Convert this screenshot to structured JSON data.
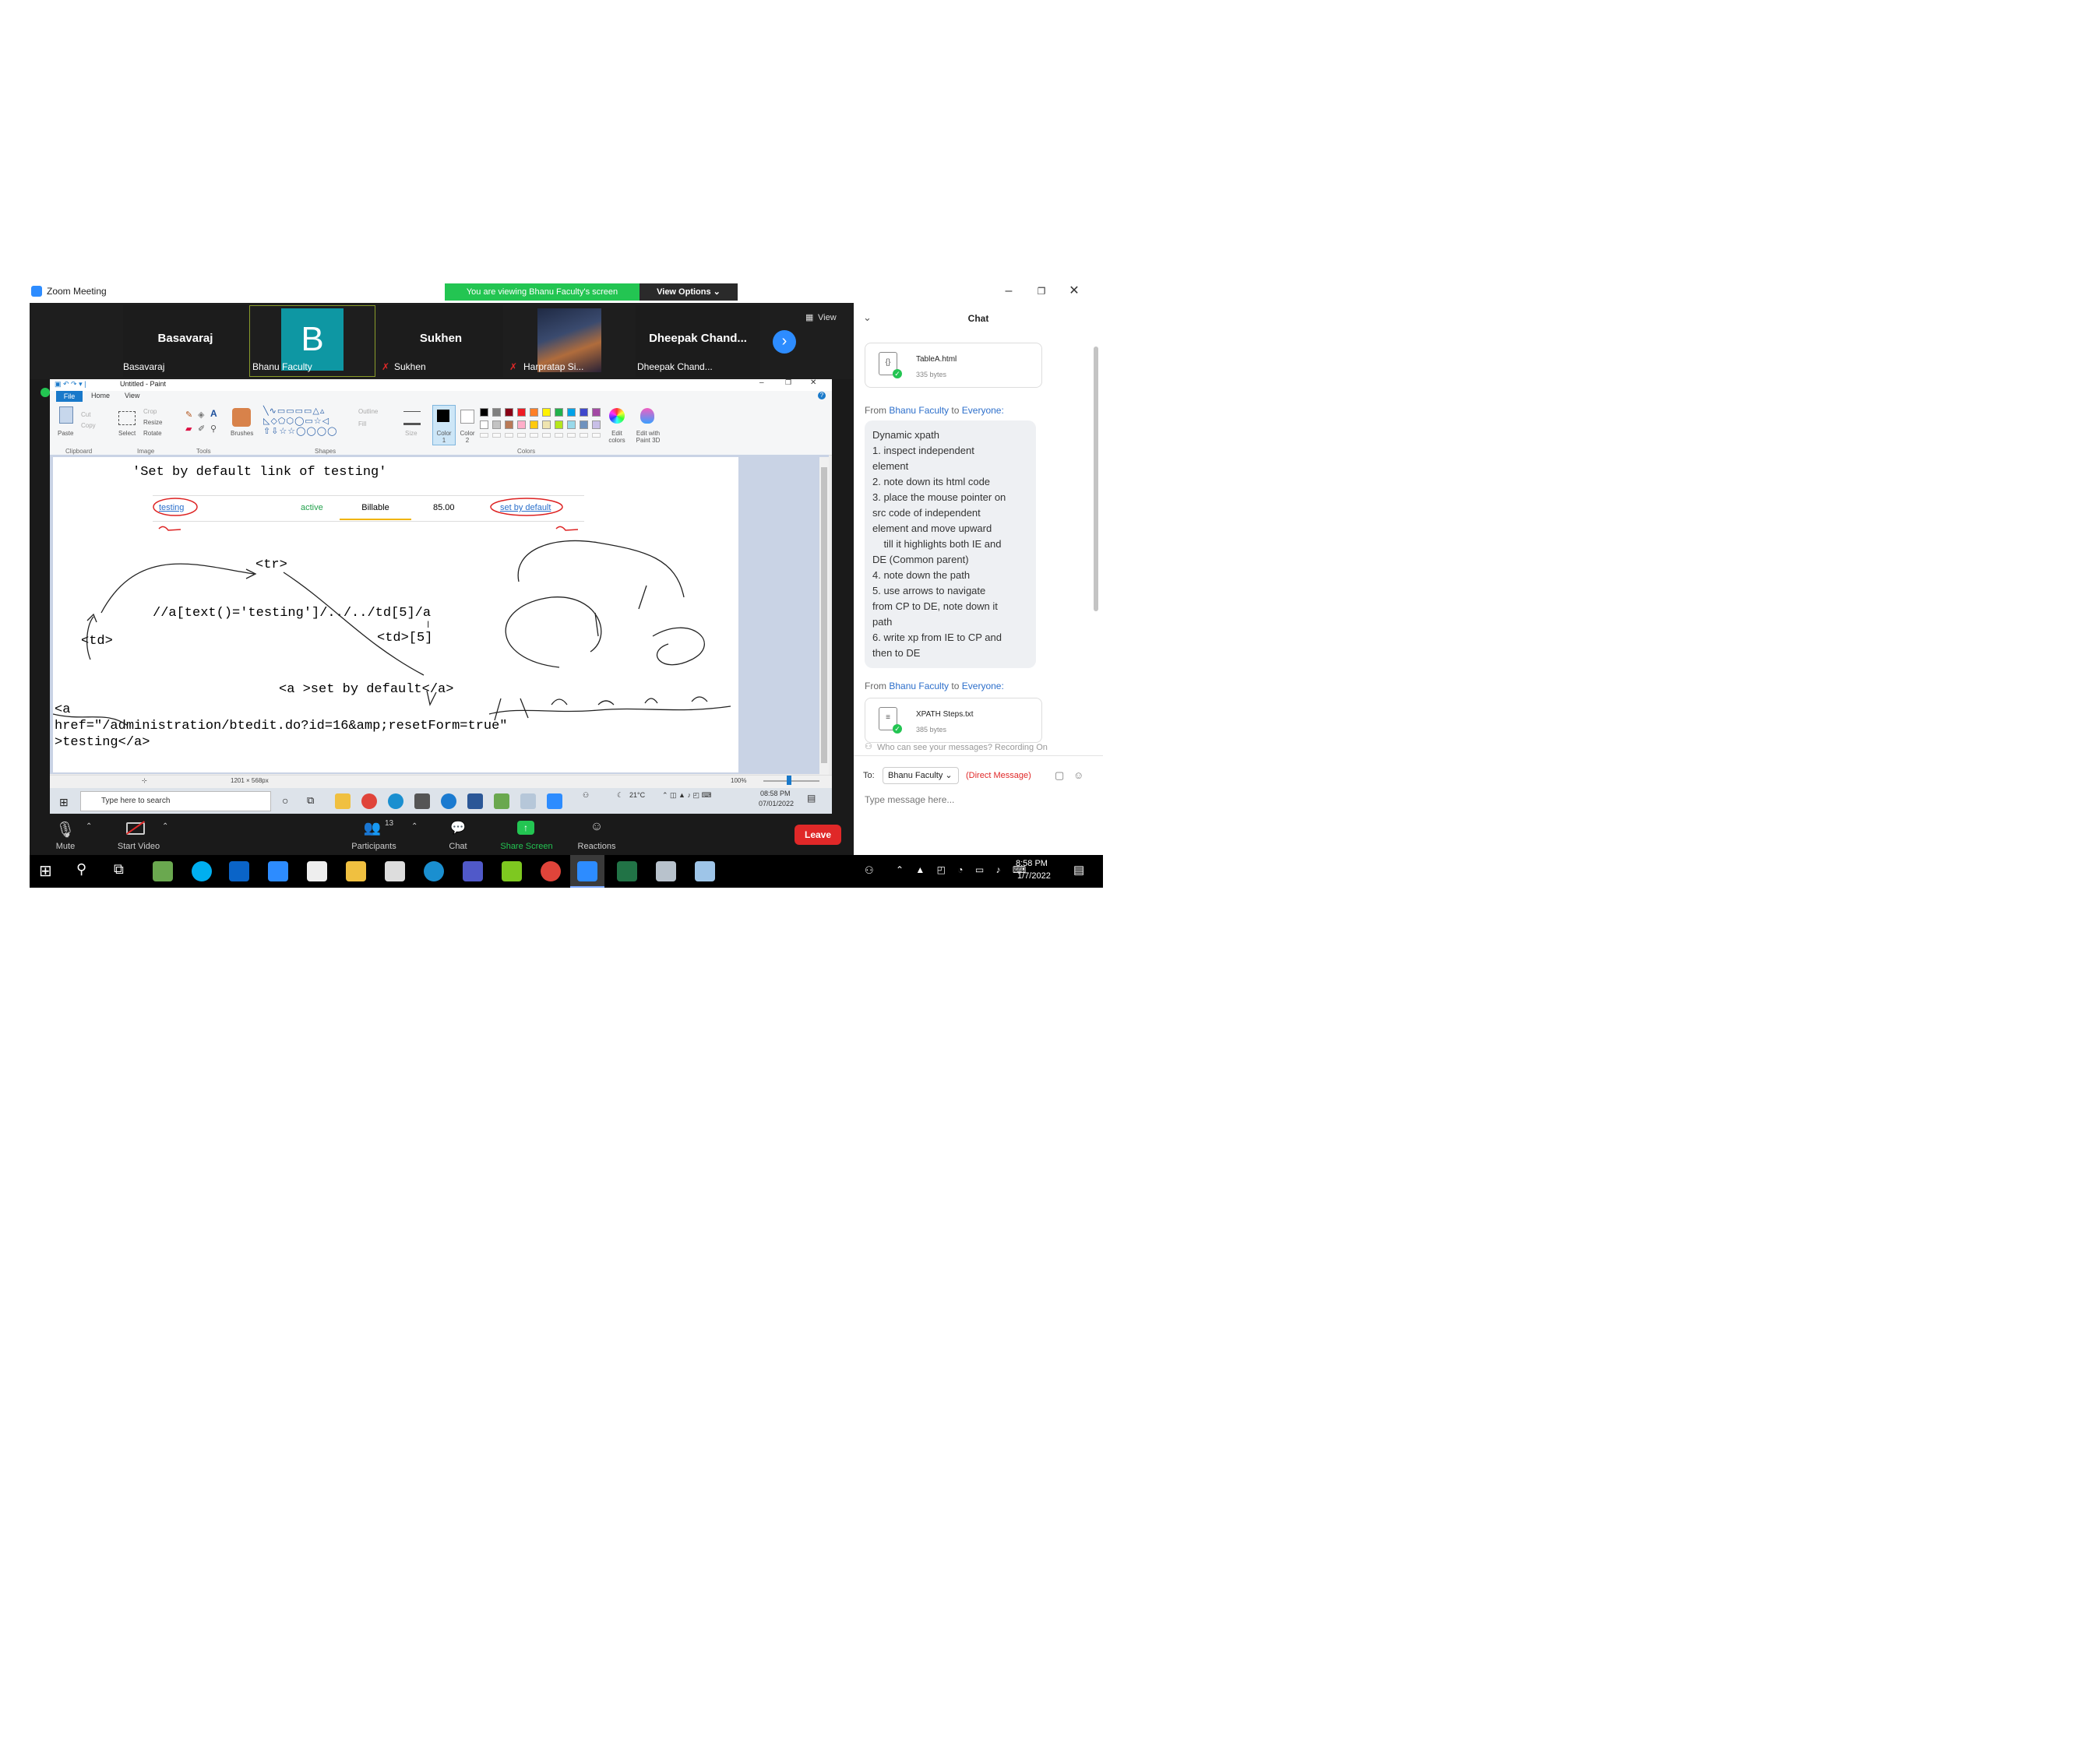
{
  "window": {
    "title": "Zoom Meeting",
    "viewing_banner": "You are viewing Bhanu Faculty's screen",
    "view_options": "View Options ⌄",
    "view_label": "View"
  },
  "participants": [
    {
      "name": "Basavaraj",
      "label": "Basavaraj"
    },
    {
      "avatar_letter": "B",
      "label": "Bhanu Faculty"
    },
    {
      "name": "Sukhen",
      "label": "Sukhen"
    },
    {
      "label": "Harpratap Si..."
    },
    {
      "name": "Dheepak  Chand...",
      "label": "Dheepak Chand..."
    }
  ],
  "paint": {
    "title": "Untitled - Paint",
    "tabs": [
      "File",
      "Home",
      "View"
    ],
    "ribbon": {
      "clipboard": {
        "label": "Clipboard",
        "paste": "Paste",
        "cut": "Cut",
        "copy": "Copy"
      },
      "image": {
        "label": "Image",
        "select": "Select",
        "crop": "Crop",
        "resize": "Resize",
        "rotate": "Rotate"
      },
      "tools": {
        "label": "Tools"
      },
      "brushes": "Brushes",
      "shapes": {
        "label": "Shapes",
        "outline": "Outline",
        "fill": "Fill"
      },
      "size": "Size",
      "color1": "Color 1",
      "color2": "Color 2",
      "colors": {
        "label": "Colors",
        "edit": "Edit colors",
        "paint3d": "Edit with Paint 3D"
      }
    },
    "palette": [
      "#000000",
      "#7f7f7f",
      "#880015",
      "#ed1c24",
      "#ff7f27",
      "#fff200",
      "#22b14c",
      "#00a2e8",
      "#3f48cc",
      "#a349a4",
      "#ffffff",
      "#c3c3c3",
      "#b97a57",
      "#ffaec9",
      "#ffc90e",
      "#efe4b0",
      "#b5e61d",
      "#99d9ea",
      "#7092be",
      "#c8bfe7"
    ],
    "status": {
      "dimensions": "1201 × 568px",
      "zoom": "100%"
    }
  },
  "canvas": {
    "heading": "'Set by default link of testing'",
    "table": [
      "testing",
      "active",
      "Billable",
      "85.00",
      "set by default"
    ],
    "tr": "<tr>",
    "xpath": "//a[text()='testing']/../../td[5]/a",
    "td": "<td>",
    "td5": "<td>[5]",
    "anchor_tag": "<a >set by default</a>",
    "html_line1": "<a",
    "html_line2": "href=\"/administration/btedit.do?id=16&amp;resetForm=true\"",
    "html_line3": ">testing</a>"
  },
  "inner_taskbar": {
    "search_placeholder": "Type here to search",
    "weather": "21°C",
    "time": "08:58 PM",
    "date": "07/01/2022"
  },
  "toolbar": {
    "mute": "Mute",
    "start_video": "Start Video",
    "participants": "Participants",
    "participants_count": "13",
    "chat": "Chat",
    "share_screen": "Share Screen",
    "reactions": "Reactions",
    "leave": "Leave"
  },
  "chat": {
    "title": "Chat",
    "messages": [
      {
        "type": "file",
        "name": "TableA.html",
        "size": "335 bytes"
      },
      {
        "type": "text",
        "from": "Bhanu Faculty",
        "to": "Everyone:",
        "lines": [
          "Dynamic xpath",
          "1. inspect independent",
          "element",
          "2. note down its html code",
          "3. place the mouse pointer on",
          "src code of independent",
          "element and move upward",
          "    till it highlights both IE and",
          "DE (Common parent)",
          "4. note down the path",
          "5. use arrows to navigate",
          "from CP to DE, note down it",
          "path",
          "6. write xp from IE to CP and",
          "then to DE"
        ]
      },
      {
        "type": "file",
        "from": "Bhanu Faculty",
        "to": "Everyone:",
        "name": "XPATH Steps.txt",
        "size": "385 bytes"
      }
    ],
    "from_prefix": "From",
    "to_word": "to",
    "privacy": "Who can see your messages? Recording On",
    "to_label": "To:",
    "to_select": "Bhanu Faculty ⌄",
    "direct_message": "(Direct Message)",
    "input_placeholder": "Type message here..."
  },
  "host_taskbar": {
    "time": "8:58 PM",
    "date": "1/7/2022"
  }
}
